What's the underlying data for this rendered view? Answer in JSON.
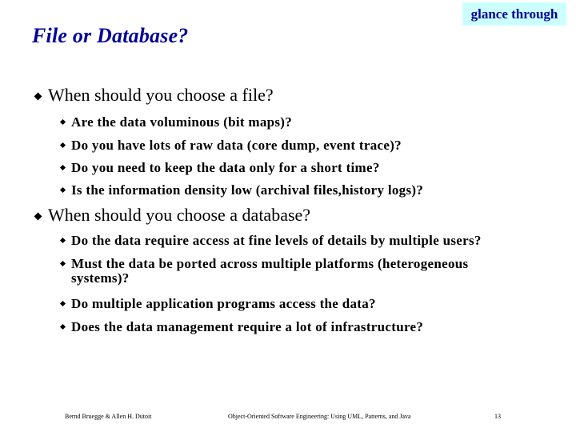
{
  "slide": {
    "title": "File or Database?",
    "badge": "glance through",
    "sections": [
      {
        "heading": "When should you  choose a file?",
        "items": [
          "Are the data voluminous (bit maps)?",
          "Do you have lots of raw data (core dump, event trace)?",
          "Do you need to keep the data only for a short time?",
          "Is the information density low (archival files,history logs)?"
        ]
      },
      {
        "heading": "When should you choose a database?",
        "items": [
          "Do the data require access at fine levels of details by multiple users?",
          "Must the data be ported across multiple platforms (heterogeneous",
          "Do multiple application programs access the data?",
          "Does the data management require a lot of infrastructure?"
        ],
        "item_continuations": {
          "1": "systems)?"
        }
      }
    ],
    "footer": {
      "authors": "Bernd Bruegge & Allen H. Dutoit",
      "book": "Object-Oriented Software Engineering: Using UML, Patterns, and Java",
      "page": "13"
    }
  }
}
